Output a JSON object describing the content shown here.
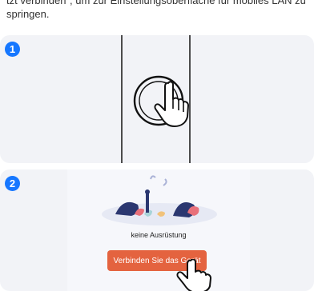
{
  "intro": {
    "text": "tzt verbinden\", um zur Einstellungsoberfläche für mobiles LAN zu springen."
  },
  "steps": [
    {
      "number": "1"
    },
    {
      "number": "2"
    }
  ],
  "app_screen": {
    "empty_label": "keine Ausrüstung",
    "connect_button": "Verbinden Sie das Gerät"
  },
  "colors": {
    "step_badge": "#1677ff",
    "button": "#e4633f",
    "card_bg": "#f2f3f7"
  },
  "icons": [
    "hand-pointer-icon",
    "power-button-icon",
    "empty-state-illustration"
  ]
}
